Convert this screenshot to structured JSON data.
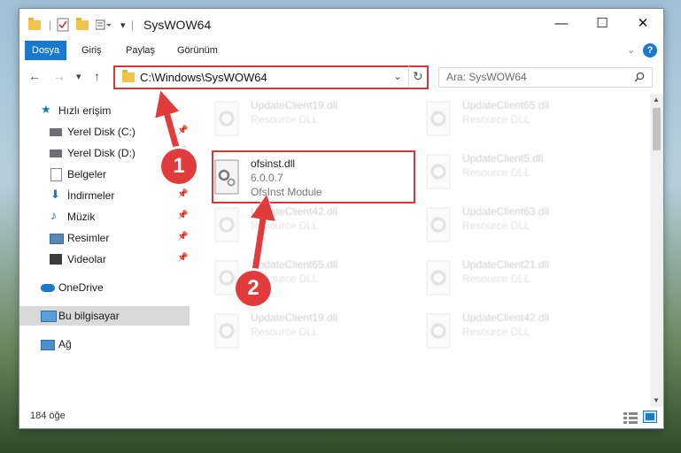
{
  "window": {
    "title": "SysWOW64",
    "controls": {
      "minimize": "—",
      "maximize": "☐",
      "close": "✕"
    }
  },
  "ribbon": {
    "tabs": [
      "Dosya",
      "Giriş",
      "Paylaş",
      "Görünüm"
    ],
    "active_tab": "Dosya"
  },
  "address": {
    "path": "C:\\Windows\\SysWOW64",
    "search_placeholder": "Ara: SysWOW64"
  },
  "sidebar": {
    "items": [
      {
        "label": "Hızlı erişim",
        "icon": "star-icon",
        "pinned": false
      },
      {
        "label": "Yerel Disk (C:)",
        "icon": "drive-icon",
        "pinned": true
      },
      {
        "label": "Yerel Disk (D:)",
        "icon": "drive-icon",
        "pinned": true
      },
      {
        "label": "Belgeler",
        "icon": "documents-icon",
        "pinned": true
      },
      {
        "label": "İndirmeler",
        "icon": "download-icon",
        "pinned": true
      },
      {
        "label": "Müzik",
        "icon": "music-icon",
        "pinned": true
      },
      {
        "label": "Resimler",
        "icon": "pictures-icon",
        "pinned": true
      },
      {
        "label": "Videolar",
        "icon": "video-icon",
        "pinned": true
      },
      {
        "label": "OneDrive",
        "icon": "cloud-icon",
        "pinned": false
      },
      {
        "label": "Bu bilgisayar",
        "icon": "computer-icon",
        "pinned": false
      },
      {
        "label": "Ağ",
        "icon": "network-icon",
        "pinned": false
      }
    ],
    "selected": "Bu bilgisayar"
  },
  "files": {
    "highlighted": {
      "name": "ofsinst.dll",
      "version": "6.0.0.7",
      "description": "OfsInst Module"
    },
    "background": [
      {
        "name": "UpdateClient19.dll",
        "desc": "Resource DLL"
      },
      {
        "name": "UpdateClient65.dll",
        "desc": "Resource DLL"
      },
      {
        "name": "UpdateClient5.dll",
        "desc": "Resource DLL"
      },
      {
        "name": "UpdateClient42.dll",
        "desc": "Resource DLL"
      },
      {
        "name": "UpdateClient63.dll",
        "desc": "Resource DLL"
      },
      {
        "name": "UpdateClient65.dll",
        "desc": "Resource DLL"
      },
      {
        "name": "UpdateClient21.dll",
        "desc": "Resource DLL"
      },
      {
        "name": "UpdateClient19.dll",
        "desc": "Resource DLL"
      },
      {
        "name": "UpdateClient42.dll",
        "desc": "Resource DLL"
      }
    ]
  },
  "status": {
    "item_count": "184 öğe"
  },
  "annotations": {
    "step1": "1",
    "step2": "2"
  },
  "colors": {
    "accent": "#1979ca",
    "highlight": "#d03a3a",
    "folder": "#f3c44c"
  }
}
